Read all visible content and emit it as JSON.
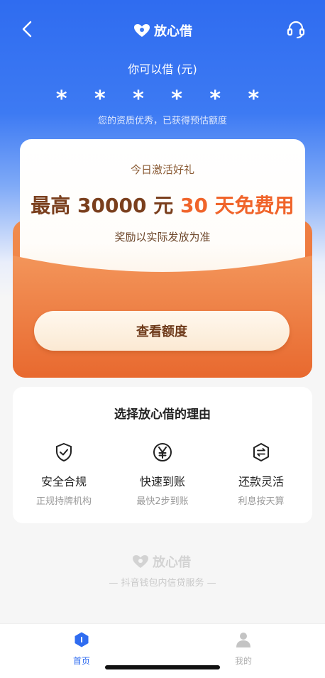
{
  "header": {
    "brand": "放心借",
    "back_icon": "chevron-left-icon",
    "service_icon": "headset-icon"
  },
  "quota": {
    "label": "你可以借 (元)",
    "masked_amount": "* * * * * *",
    "note": "您的资质优秀，已获得预估额度"
  },
  "promo": {
    "title": "今日激活好礼",
    "headline_part1": "最高 30000 元",
    "headline_part2": "30 天免费用",
    "note": "奖励以实际发放为准",
    "cta_label": "查看额度"
  },
  "reasons": {
    "title": "选择放心借的理由",
    "items": [
      {
        "icon": "shield-check-icon",
        "title": "安全合规",
        "subtitle": "正规持牌机构"
      },
      {
        "icon": "yen-coin-icon",
        "title": "快速到账",
        "subtitle": "最快2步到账"
      },
      {
        "icon": "repay-arrows-icon",
        "title": "还款灵活",
        "subtitle": "利息按天算"
      }
    ]
  },
  "footer": {
    "brand": "放心借",
    "tagline": "— 抖音钱包内信贷服务 —"
  },
  "tabbar": {
    "items": [
      {
        "label": "首页",
        "icon": "home-icon",
        "active": true
      },
      {
        "label": "我的",
        "icon": "user-icon",
        "active": false
      }
    ]
  },
  "colors": {
    "primary_blue": "#2f6cf0",
    "envelope_orange": "#ee7a3f",
    "highlight_orange": "#f0642a",
    "active_tab": "#2f6cf0"
  }
}
